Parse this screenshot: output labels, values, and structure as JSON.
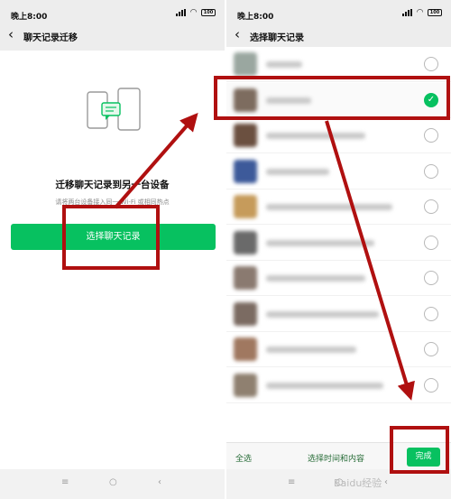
{
  "left_screen": {
    "status": {
      "time": "晚上8:00",
      "battery": "100"
    },
    "nav": {
      "title": "聊天记录迁移"
    },
    "main": {
      "heading": "迁移聊天记录到另一台设备",
      "subtext": "请将两台设备接入同一 Wi-Fi 或相同热点",
      "button_label": "选择聊天记录"
    }
  },
  "right_screen": {
    "status": {
      "time": "晚上8:00",
      "battery": "100"
    },
    "nav": {
      "title": "选择聊天记录"
    },
    "rows": [
      {
        "checked": false,
        "avatar_color": "#9aa7a0",
        "text_width": 40
      },
      {
        "checked": true,
        "avatar_color": "#7d6c5f",
        "text_width": 50
      },
      {
        "checked": false,
        "avatar_color": "#6b5040",
        "text_width": 110
      },
      {
        "checked": false,
        "avatar_color": "#3d5a9a",
        "text_width": 70
      },
      {
        "checked": false,
        "avatar_color": "#c69b5b",
        "text_width": 140
      },
      {
        "checked": false,
        "avatar_color": "#6a6a6a",
        "text_width": 120
      },
      {
        "checked": false,
        "avatar_color": "#8a7a70",
        "text_width": 110
      },
      {
        "checked": false,
        "avatar_color": "#7b6b62",
        "text_width": 125
      },
      {
        "checked": false,
        "avatar_color": "#a07860",
        "text_width": 100
      },
      {
        "checked": false,
        "avatar_color": "#8f8070",
        "text_width": 130
      }
    ],
    "bottom": {
      "select_all": "全选",
      "time_content": "选择时间和内容",
      "done": "完成"
    }
  },
  "system_nav": {
    "menu": "≡",
    "home": "○",
    "back": "‹"
  },
  "watermark": "Baidu经验",
  "annotation_color": "#b01010"
}
